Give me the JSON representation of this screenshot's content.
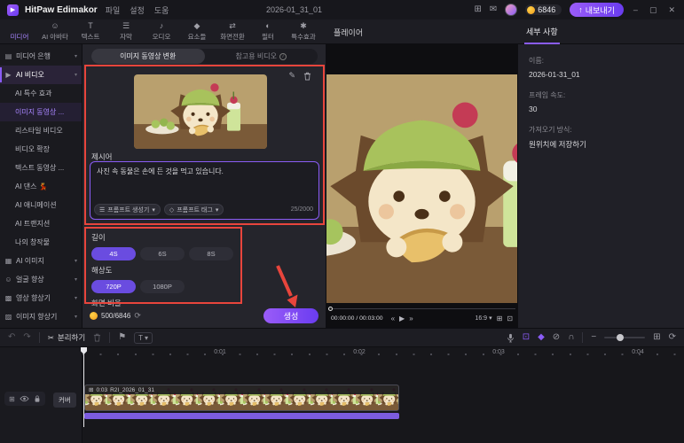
{
  "titlebar": {
    "app_name": "HitPaw Edimakor",
    "menus": [
      {
        "label": "파일"
      },
      {
        "label": "설정"
      },
      {
        "label": "도움"
      }
    ],
    "project_title": "2026-01_31_01",
    "credits": "6846",
    "export_label": "내보내기"
  },
  "ribbon": {
    "tabs": [
      {
        "label": "미디어"
      },
      {
        "label": "AI 아바타"
      },
      {
        "label": "텍스트"
      },
      {
        "label": "자막"
      },
      {
        "label": "오디오"
      },
      {
        "label": "요소들"
      },
      {
        "label": "화면전환"
      },
      {
        "label": "필터"
      },
      {
        "label": "특수효과"
      }
    ],
    "player_label": "플레이어",
    "details_tab_label": "세부 사항"
  },
  "sidebar": {
    "items": [
      {
        "label": "미디어 은행"
      },
      {
        "label": "AI 비디오"
      },
      {
        "label": "AI 특수 효과"
      },
      {
        "label": "이미지 동영상 ..."
      },
      {
        "label": "리스타일 비디오"
      },
      {
        "label": "비디오 확장"
      },
      {
        "label": "텍스트 동영상 ..."
      },
      {
        "label": "AI 댄스 💃"
      },
      {
        "label": "AI 애니메이션"
      },
      {
        "label": "AI 트랜지션"
      },
      {
        "label": "나의 창작물"
      },
      {
        "label": "AI 이미지"
      },
      {
        "label": "얼굴 향상"
      },
      {
        "label": "영상 향상기"
      },
      {
        "label": "이미지 향상기"
      }
    ]
  },
  "ai_panel": {
    "tab_convert": "이미지 동영상 변환",
    "tab_reference": "참고용 비디오",
    "prompt_label": "제시어",
    "prompt_text": "사진 속 동물은 손에 든 것을 먹고 있습니다.",
    "prompt_generator_label": "프롬프트 생성기",
    "prompt_tag_label": "프롬프트 태그",
    "char_counter": "25/2000",
    "length_label": "길이",
    "length_options": [
      {
        "label": "4S"
      },
      {
        "label": "6S"
      },
      {
        "label": "8S"
      }
    ],
    "length_selected": "4S",
    "resolution_label": "해상도",
    "resolution_options": [
      {
        "label": "720P"
      },
      {
        "label": "1080P"
      }
    ],
    "resolution_selected": "720P",
    "ratio_label": "화면 비율",
    "credit_counter": "500/6846",
    "generate_label": "생성"
  },
  "player": {
    "time_display": "00:00:00 / 00:03:00",
    "ratio_value": "16:9"
  },
  "details": {
    "name_label": "이름:",
    "name_value": "2026-01-31_01",
    "fps_label": "프레임 속도:",
    "fps_value": "30",
    "import_label": "가져오기 방식:",
    "import_value": "원위치에 저장하기"
  },
  "timeline": {
    "split_label": "분리하기",
    "ruler_marks": [
      {
        "label": "0:01"
      },
      {
        "label": "0:02"
      },
      {
        "label": "0:03"
      },
      {
        "label": "0:04"
      }
    ],
    "clip_duration": "0:03",
    "clip_name": "R2I_2026_01_31",
    "cover_label": "커버"
  },
  "colors": {
    "accent_purple": "#8a5cf5",
    "selected_purple": "#6a4ce0",
    "annotation_red": "#e8453c",
    "coin_orange": "#f0a11c",
    "audio_track_purple": "#7c5ce0"
  },
  "icons": {
    "logo_play": "▶",
    "layout": "⊞",
    "message": "✉",
    "export_arrow": "↑",
    "minimize": "–",
    "maximize": "▢",
    "close": "✕",
    "tab_avatar": "☺",
    "tab_text": "T",
    "tab_subtitle": "☰",
    "tab_audio": "♪",
    "tab_elements": "◆",
    "tab_transition": "⇄",
    "tab_filter": "◐",
    "tab_effects": "✱",
    "folder": "▤",
    "film": "▶",
    "image": "▦",
    "face": "☺",
    "video_enhance": "▩",
    "image_enhance": "▨",
    "chev_down": "▾",
    "info": "i",
    "edit": "✎",
    "menu": "☰",
    "tag": "◇",
    "refresh": "⟳",
    "prev": "«",
    "play": "▶",
    "next": "»",
    "grid": "⊞",
    "expand": "⊡",
    "undo": "↶",
    "redo": "↷",
    "scissors": "✂",
    "marker": "⚑",
    "text_tool": "T",
    "caption": "⊡",
    "keyframe": "◆",
    "mute": "⊘",
    "magnet": "∩",
    "zoom_out": "−",
    "fit": "⊞",
    "circle_arrow": "⟳"
  }
}
